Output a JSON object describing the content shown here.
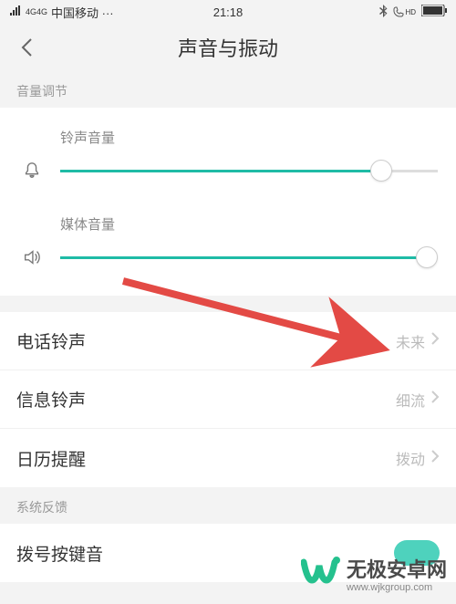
{
  "status": {
    "signal_label": "4G4G",
    "carrier": "中国移动 ···",
    "time": "21:18",
    "hd_label": "HD"
  },
  "nav": {
    "title": "声音与振动"
  },
  "sections": {
    "volume_header": "音量调节",
    "system_feedback_header": "系统反馈"
  },
  "sliders": {
    "ring": {
      "label": "铃声音量",
      "value_pct": 85
    },
    "media": {
      "label": "媒体音量",
      "value_pct": 97
    }
  },
  "rows": {
    "phone_ring": {
      "label": "电话铃声",
      "value": "未来"
    },
    "message_ring": {
      "label": "信息铃声",
      "value": "细流"
    },
    "calendar_alert": {
      "label": "日历提醒",
      "value": "拨动"
    },
    "dial_tone": {
      "label": "拨号按键音"
    }
  },
  "watermark": {
    "brand": "无极安卓网",
    "url": "www.wjkgroup.com"
  },
  "colors": {
    "accent": "#1fbba6",
    "arrow": "#e34a45"
  }
}
